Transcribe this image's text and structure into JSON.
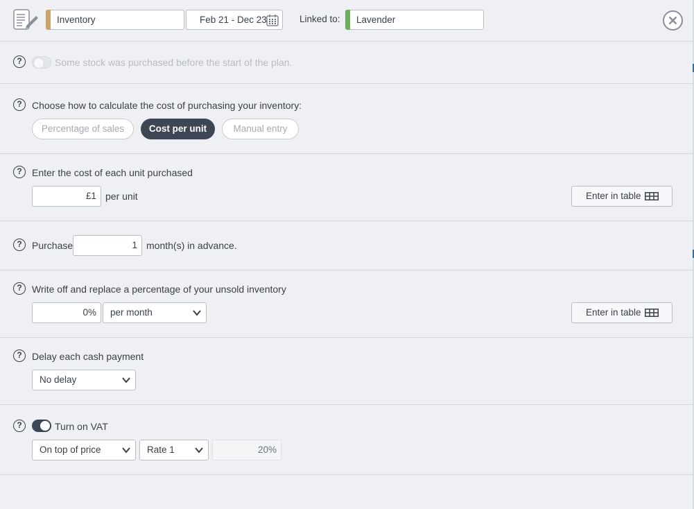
{
  "header": {
    "name_value": "Inventory",
    "name_stripe_color": "#c9a46b",
    "date_range": "Feb 21 - Dec 23",
    "linked_label": "Linked to:",
    "linked_value": "Lavender",
    "linked_stripe_color": "#6fae5b"
  },
  "opening_stock": {
    "label": "Some stock was purchased before the start of the plan.",
    "enabled": false
  },
  "cost_method": {
    "label": "Choose how to calculate the cost of purchasing your inventory:",
    "options": [
      "Percentage of sales",
      "Cost per unit",
      "Manual entry"
    ],
    "selected": "Cost per unit"
  },
  "unit_cost": {
    "label": "Enter the cost of each unit purchased",
    "value": "£1",
    "suffix": "per unit",
    "table_button": "Enter in table"
  },
  "purchase_advance": {
    "prefix": "Purchase",
    "value": "1",
    "suffix": "month(s) in advance."
  },
  "write_off": {
    "label": "Write off and replace a percentage of your unsold inventory",
    "value": "0%",
    "period": "per month",
    "table_button": "Enter in table"
  },
  "cash_delay": {
    "label": "Delay each cash payment",
    "value": "No delay"
  },
  "vat": {
    "label": "Turn on VAT",
    "enabled": true,
    "mode": "On top of price",
    "rate": "Rate 1",
    "rate_value": "20%"
  },
  "help_glyph": "?",
  "colors": {
    "dark": "#3d4654",
    "background": "#eef0f3"
  }
}
